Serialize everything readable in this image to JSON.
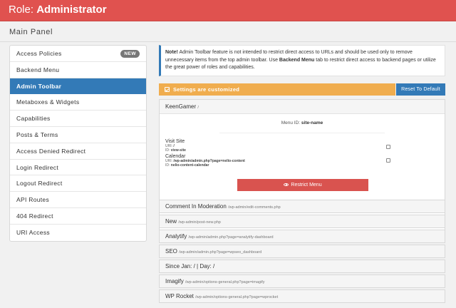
{
  "header": {
    "title_prefix": "Role:",
    "title_role": "Administrator"
  },
  "panel": {
    "title": "Main Panel"
  },
  "sidebar": {
    "items": [
      {
        "label": "Access Policies",
        "badge": "NEW"
      },
      {
        "label": "Backend Menu"
      },
      {
        "label": "Admin Toolbar",
        "active": true
      },
      {
        "label": "Metaboxes & Widgets"
      },
      {
        "label": "Capabilities"
      },
      {
        "label": "Posts & Terms"
      },
      {
        "label": "Access Denied Redirect"
      },
      {
        "label": "Login Redirect"
      },
      {
        "label": "Logout Redirect"
      },
      {
        "label": "API Routes"
      },
      {
        "label": "404 Redirect"
      },
      {
        "label": "URI Access"
      }
    ]
  },
  "notice": {
    "strong": "Note!",
    "text1": " Admin Toolbar feature is not intended to restrict direct access to URLs and should be used only to remove unnecessary items from the top admin toolbar. Use ",
    "link": "Backend Menu",
    "text2": " tab to restrict direct access to backend pages or utilize the great power of roles and capabilities."
  },
  "settings": {
    "message": "Settings are customized",
    "reset_label": "Reset To Default"
  },
  "open_group": {
    "title": "KeenGamer",
    "path": "/",
    "menu_id_label": "Menu ID:",
    "menu_id_value": "site-name",
    "items": [
      {
        "name": "Visit Site",
        "uri_label": "URI:",
        "uri": "/",
        "id_label": "ID:",
        "id": "view-site"
      },
      {
        "name": "Calendar",
        "uri_label": "URI:",
        "uri": "/wp-admin/admin.php?page=nelio-content",
        "id_label": "ID:",
        "id": "nelio-content-calendar"
      }
    ],
    "restrict_label": "Restrict Menu"
  },
  "groups": [
    {
      "title": "Comment In Moderation",
      "path": "/wp-admin/edit-comments.php"
    },
    {
      "title": "New",
      "path": "/wp-admin/post-new.php"
    },
    {
      "title": "Analytify",
      "path": "/wp-admin/admin.php?page=analytify-dashboard"
    },
    {
      "title": "SEO",
      "path": "/wp-admin/admin.php?page=wpseo_dashboard"
    },
    {
      "title": "Since  Jan: / | Day: /",
      "path": ""
    },
    {
      "title": "Imagify",
      "path": "/wp-admin/options-general.php?page=imagify"
    },
    {
      "title": "WP Rocket",
      "path": "/wp-admin/options-general.php?page=wprocket"
    }
  ],
  "colors": {
    "header": "#e0524f",
    "active": "#337ab7",
    "warning": "#f0ad4e",
    "danger": "#d9534f"
  }
}
